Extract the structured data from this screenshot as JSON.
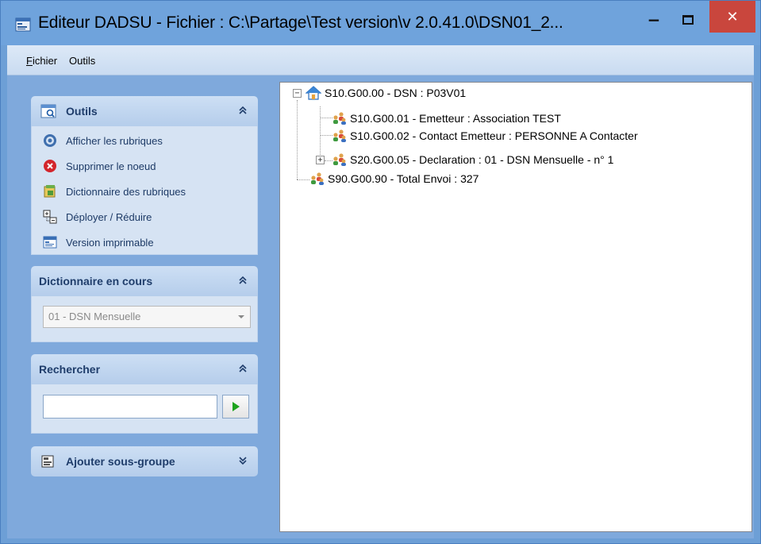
{
  "window": {
    "title": "Editeur DADSU - Fichier : C:\\Partage\\Test version\\v 2.0.41.0\\DSN01_2...",
    "minimize_glyph": "−",
    "close_glyph": "✕"
  },
  "menu": {
    "items": [
      {
        "first": "F",
        "rest": "ichier"
      },
      {
        "first": "",
        "rest": "Outils"
      }
    ]
  },
  "outils_panel": {
    "title": "Outils",
    "collapsed": false,
    "items": [
      {
        "label": "Afficher les rubriques",
        "icon": "view-fields-icon"
      },
      {
        "label": "Supprimer le noeud",
        "icon": "delete-icon"
      },
      {
        "label": "Dictionnaire des rubriques",
        "icon": "dictionary-icon"
      },
      {
        "label": "Déployer / Réduire",
        "icon": "expand-collapse-icon"
      },
      {
        "label": "Version imprimable",
        "icon": "printable-version-icon"
      }
    ]
  },
  "dictionnaire_panel": {
    "title": "Dictionnaire en cours",
    "selected": "01 - DSN Mensuelle"
  },
  "recherche_panel": {
    "title": "Rechercher",
    "input_value": ""
  },
  "ajouter_panel": {
    "title": "Ajouter sous-groupe",
    "collapsed": true
  },
  "tree": {
    "root": "S10.G00.00 - DSN : P03V01",
    "children": [
      "S10.G00.01 - Emetteur : Association TEST",
      "S10.G00.02 - Contact Emetteur : PERSONNE A Contacter",
      "S20.G00.05 - Declaration : 01 - DSN Mensuelle - n° 1"
    ],
    "sibling": "S90.G00.90 - Total Envoi : 327"
  },
  "colors": {
    "title_bar": "#6fa3dc",
    "close_button": "#c9463d",
    "panel_title": "#1f3d6b",
    "task_text": "#1d3a66"
  }
}
